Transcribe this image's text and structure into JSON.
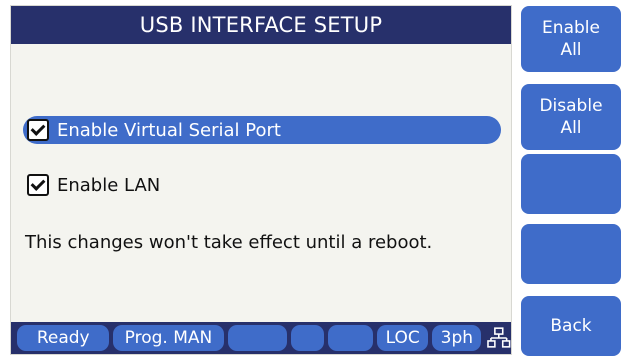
{
  "header": {
    "title": "USB INTERFACE SETUP"
  },
  "options": [
    {
      "label": "Enable Virtual Serial Port",
      "checked": true,
      "selected": true
    },
    {
      "label": "Enable LAN",
      "checked": true,
      "selected": false
    }
  ],
  "message": "This changes won't take effect until a reboot.",
  "status_bar": {
    "ready": "Ready",
    "prog_mode": "Prog. MAN",
    "empty1": "",
    "empty2": "",
    "empty3": "",
    "loc": "LOC",
    "phase": "3ph",
    "network_icon": "network-icon"
  },
  "side_buttons": {
    "enable_all": [
      "Enable",
      "All"
    ],
    "disable_all": [
      "Disable",
      "All"
    ],
    "blank1": "",
    "blank2": "",
    "back": "Back"
  },
  "colors": {
    "header_bg": "#27306b",
    "accent": "#3f6cc9",
    "panel_bg": "#f4f4ef"
  }
}
